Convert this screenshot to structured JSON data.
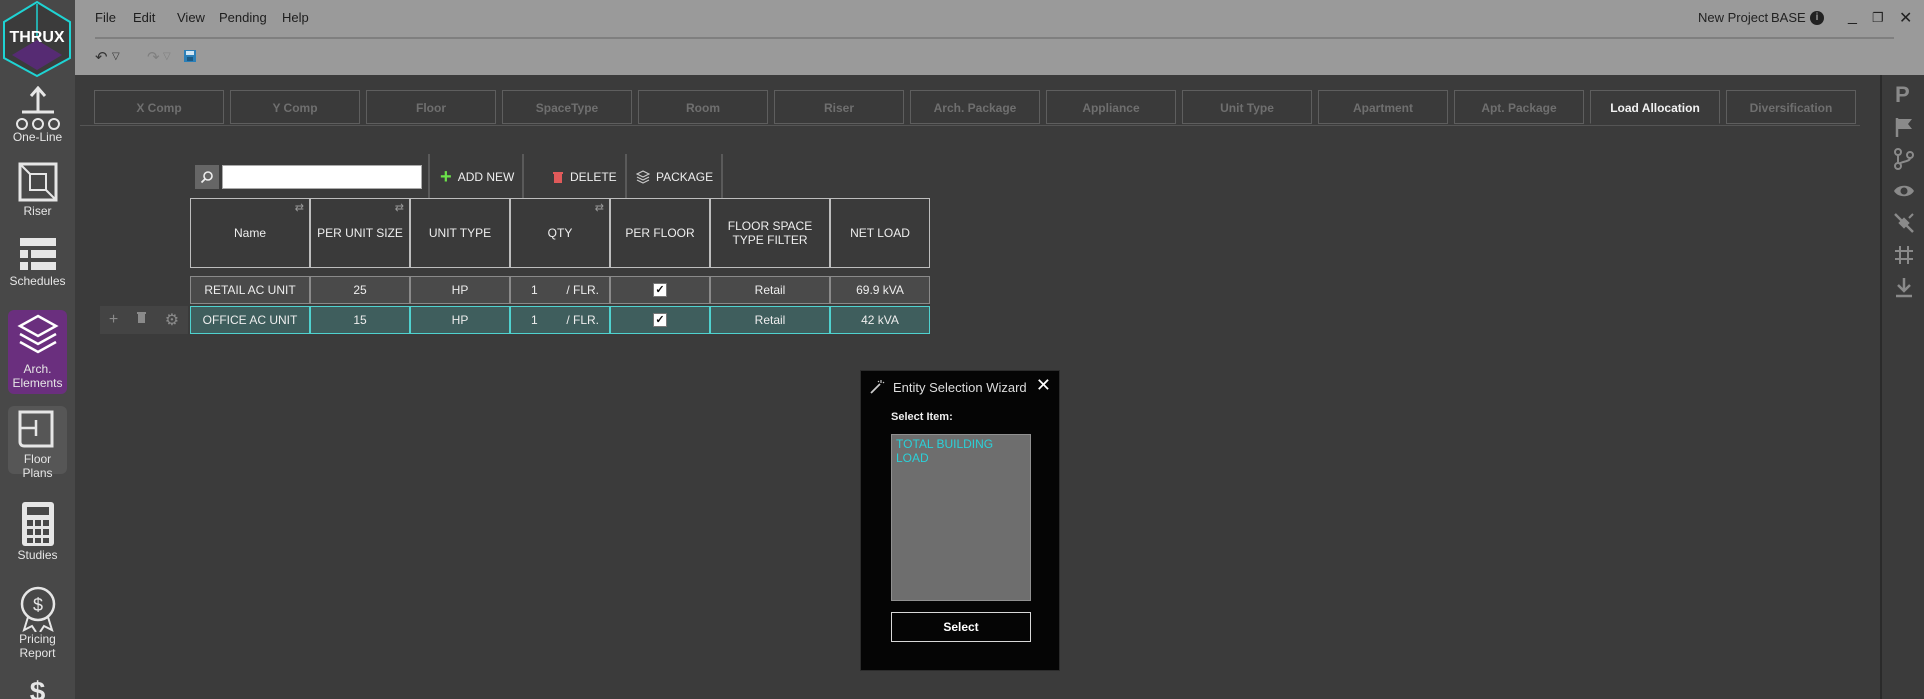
{
  "logo": {
    "text": "THRUX"
  },
  "sidebar": {
    "items": [
      {
        "label": "One-Line"
      },
      {
        "label": "Riser"
      },
      {
        "label": "Schedules"
      },
      {
        "label": "Arch.\nElements"
      },
      {
        "label": "Floor Plans"
      },
      {
        "label": "Studies"
      },
      {
        "label": "Pricing\nReport"
      }
    ]
  },
  "menu": {
    "items": [
      "File",
      "Edit",
      "View",
      "Pending",
      "Help"
    ],
    "project": "New Project",
    "scenario": "BASE"
  },
  "tabs": [
    "X Comp",
    "Y Comp",
    "Floor",
    "SpaceType",
    "Room",
    "Riser",
    "Arch. Package",
    "Appliance",
    "Unit Type",
    "Apartment",
    "Apt. Package",
    "Load Allocation",
    "Diversification"
  ],
  "active_tab": "Load Allocation",
  "table_toolbar": {
    "search_value": "",
    "add_new": "ADD NEW",
    "delete": "DELETE",
    "package": "PACKAGE"
  },
  "table": {
    "columns": [
      "Name",
      "PER UNIT SIZE",
      "UNIT TYPE",
      "QTY",
      "PER FLOOR",
      "FLOOR SPACE TYPE FILTER",
      "NET LOAD"
    ],
    "rows": [
      {
        "name": "RETAIL AC UNIT",
        "size": "25",
        "unit_type": "HP",
        "qty": "1",
        "qty_suffix": "/ FLR.",
        "per_floor": true,
        "filter": "Retail",
        "net_load": "69.9 kVA"
      },
      {
        "name": "OFFICE AC UNIT",
        "size": "15",
        "unit_type": "HP",
        "qty": "1",
        "qty_suffix": "/ FLR.",
        "per_floor": true,
        "filter": "Retail",
        "net_load": "42 kVA"
      }
    ]
  },
  "dialog": {
    "title": "Entity Selection Wizard",
    "label": "Select Item:",
    "items": [
      "TOTAL BUILDING LOAD"
    ],
    "select_button": "Select"
  },
  "colors": {
    "accent": "#4fd2cf",
    "sidebar_active": "#6a2f7e",
    "topbar": "#9a9a9a"
  }
}
